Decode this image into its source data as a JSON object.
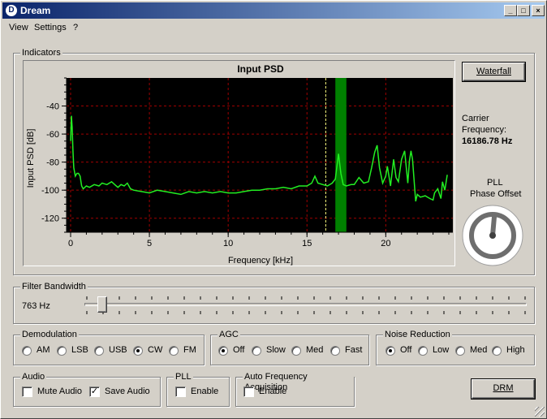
{
  "window": {
    "title": "Dream",
    "app_icon_letter": "D",
    "buttons": {
      "minimize": "_",
      "maximize": "□",
      "close": "×"
    }
  },
  "menu": [
    "View",
    "Settings",
    "?"
  ],
  "indicators": {
    "group_label": "Indicators",
    "waterfall_label": "Waterfall",
    "carrier_label_1": "Carrier",
    "carrier_label_2": "Frequency:",
    "carrier_value": "16186.78 Hz",
    "pll_label_1": "PLL",
    "pll_label_2": "Phase Offset",
    "pll_phase_deg": 5
  },
  "chart_data": {
    "type": "line",
    "title": "Input PSD",
    "xlabel": "Frequency [kHz]",
    "ylabel": "Input PSD [dB]",
    "xlim": [
      0,
      24
    ],
    "ylim": [
      -130,
      -20
    ],
    "xticks": [
      0,
      5,
      10,
      15,
      20
    ],
    "yticks": [
      -40,
      -60,
      -80,
      -100,
      -120
    ],
    "grid": true,
    "colors": {
      "background": "#000000",
      "line": "#22ee22",
      "grid": "#a00000",
      "band": "#008000",
      "marker": "#ffff80"
    },
    "dc_carrier_khz": 16.19,
    "signal_band_khz": [
      16.8,
      17.5
    ],
    "series": [
      {
        "x": [
          0.0,
          0.05,
          0.1,
          0.15,
          0.2,
          0.3,
          0.4,
          0.5,
          0.6,
          0.7,
          0.8,
          1.0,
          1.2,
          1.5,
          1.8,
          2.0,
          2.3,
          2.6,
          2.9,
          3.0,
          3.2,
          3.4,
          3.6,
          3.8,
          4.0,
          4.5,
          5.0,
          5.5,
          6.0,
          6.5,
          7.0,
          7.5,
          8.0,
          8.5,
          9.0,
          9.5,
          10.0,
          10.5,
          11.0,
          11.5,
          12.0,
          12.5,
          13.0,
          13.5,
          14.0,
          14.5,
          15.0,
          15.3,
          15.5,
          15.7,
          16.0,
          16.3,
          16.6,
          16.8,
          17.0,
          17.15,
          17.3,
          17.5,
          17.8,
          18.0,
          18.3,
          18.6,
          18.9,
          19.1,
          19.3,
          19.45,
          19.6,
          19.8,
          20.0,
          20.1,
          20.3,
          20.5,
          20.65,
          20.8,
          21.0,
          21.2,
          21.4,
          21.5,
          21.6,
          21.7,
          21.9,
          22.0,
          22.2,
          22.5,
          22.8,
          23.0,
          23.1,
          23.3,
          23.5,
          23.6,
          23.75,
          23.9
        ],
        "y": [
          -65,
          -47,
          -55,
          -72,
          -84,
          -90,
          -88,
          -88,
          -90,
          -97,
          -99,
          -97,
          -98,
          -96,
          -97,
          -95,
          -96,
          -94,
          -97,
          -98,
          -96,
          -97,
          -95,
          -99,
          -100,
          -101,
          -102,
          -100,
          -101,
          -102,
          -103,
          -101,
          -102,
          -101,
          -102,
          -101,
          -102,
          -102,
          -101,
          -100,
          -100,
          -99,
          -99,
          -98,
          -99,
          -97,
          -97,
          -95,
          -90,
          -95,
          -96,
          -97,
          -95,
          -92,
          -74,
          -88,
          -96,
          -97,
          -96,
          -96,
          -91,
          -95,
          -94,
          -84,
          -73,
          -68,
          -84,
          -95,
          -90,
          -83,
          -97,
          -78,
          -91,
          -94,
          -78,
          -72,
          -95,
          -79,
          -72,
          -78,
          -108,
          -103,
          -105,
          -104,
          -106,
          -107,
          -102,
          -99,
          -106,
          -94,
          -100,
          -89
        ]
      }
    ]
  },
  "filter": {
    "group_label": "Filter Bandwidth",
    "value_label": "763 Hz",
    "slider_fraction": 0.04
  },
  "demodulation": {
    "group_label": "Demodulation",
    "options": [
      "AM",
      "LSB",
      "USB",
      "CW",
      "FM"
    ],
    "selected": "CW"
  },
  "agc": {
    "group_label": "AGC",
    "options": [
      "Off",
      "Slow",
      "Med",
      "Fast"
    ],
    "selected": "Off"
  },
  "noise_reduction": {
    "group_label": "Noise Reduction",
    "options": [
      "Off",
      "Low",
      "Med",
      "High"
    ],
    "selected": "Off"
  },
  "audio": {
    "group_label": "Audio",
    "mute_label": "Mute Audio",
    "mute_checked": false,
    "save_label": "Save Audio",
    "save_checked": true
  },
  "pll": {
    "group_label": "PLL",
    "enable_label": "Enable",
    "enable_checked": false
  },
  "afa": {
    "group_label": "Auto Frequency Acquisition",
    "enable_label": "Enable",
    "enable_checked": false
  },
  "drm_label": "DRM"
}
